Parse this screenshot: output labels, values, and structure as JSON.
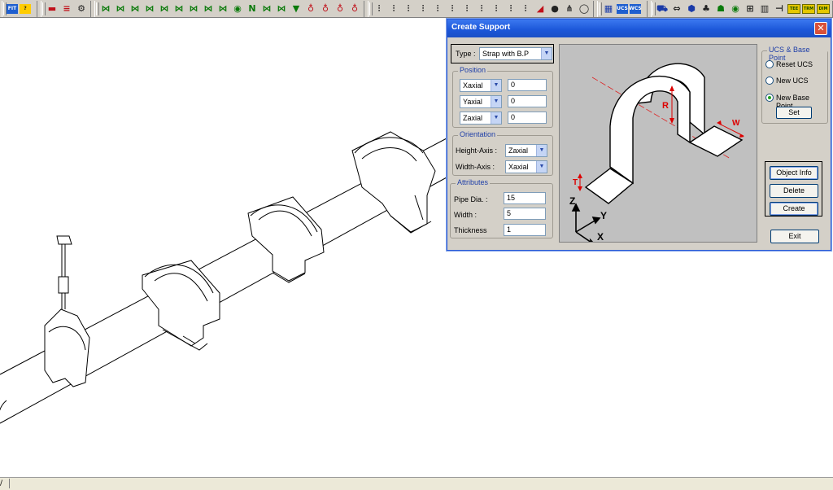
{
  "toolbar": {
    "groups": [
      {
        "buttons": [
          {
            "icon": "fit-icon",
            "label": "FIT",
            "style": "sq"
          },
          {
            "icon": "help-icon",
            "label": "?",
            "style": "ysq"
          }
        ]
      },
      {
        "buttons": [
          {
            "icon": "delete-icon",
            "label": "▬",
            "style": "red"
          },
          {
            "icon": "list-icon",
            "label": "≡",
            "style": "red"
          },
          {
            "icon": "settings-icon",
            "label": "⚙",
            "style": "dark"
          }
        ]
      },
      {
        "buttons": [
          {
            "icon": "valve-icon",
            "label": "⋈",
            "style": "green"
          },
          {
            "icon": "valve-icon",
            "label": "⋈",
            "style": "green"
          },
          {
            "icon": "valve-icon",
            "label": "⋈",
            "style": "green"
          },
          {
            "icon": "valve-icon",
            "label": "⋈",
            "style": "green"
          },
          {
            "icon": "valve-icon",
            "label": "⋈",
            "style": "green"
          },
          {
            "icon": "valve-icon",
            "label": "⋈",
            "style": "green"
          },
          {
            "icon": "valve-icon",
            "label": "⋈",
            "style": "green"
          },
          {
            "icon": "valve-icon",
            "label": "⋈",
            "style": "green"
          },
          {
            "icon": "valve-icon",
            "label": "⋈",
            "style": "green"
          },
          {
            "icon": "valve-icon",
            "label": "◉",
            "style": "green"
          },
          {
            "icon": "valve-icon",
            "label": "N",
            "style": "green"
          },
          {
            "icon": "valve-icon",
            "label": "⋈",
            "style": "green"
          },
          {
            "icon": "valve-icon",
            "label": "⋈",
            "style": "green"
          },
          {
            "icon": "valve-icon",
            "label": "▼",
            "style": "green"
          },
          {
            "icon": "spring-icon",
            "label": "♁",
            "style": "red"
          },
          {
            "icon": "spring-icon",
            "label": "♁",
            "style": "red"
          },
          {
            "icon": "spring-icon",
            "label": "♁",
            "style": "red"
          },
          {
            "icon": "spring-icon",
            "label": "♁",
            "style": "red"
          }
        ]
      },
      {
        "buttons": [
          {
            "icon": "support-icon",
            "label": "⫶",
            "style": "dark"
          },
          {
            "icon": "support-icon",
            "label": "⫶",
            "style": "dark"
          },
          {
            "icon": "support-icon",
            "label": "⫶",
            "style": "dark"
          },
          {
            "icon": "support-icon",
            "label": "⫶",
            "style": "dark"
          },
          {
            "icon": "support-icon",
            "label": "⫶",
            "style": "dark"
          },
          {
            "icon": "support-icon",
            "label": "⫶",
            "style": "dark"
          },
          {
            "icon": "support-icon",
            "label": "⫶",
            "style": "dark"
          },
          {
            "icon": "support-icon",
            "label": "⫶",
            "style": "dark"
          },
          {
            "icon": "support-icon",
            "label": "⫶",
            "style": "dark"
          },
          {
            "icon": "support-icon",
            "label": "⫶",
            "style": "dark"
          },
          {
            "icon": "support-icon",
            "label": "⫶",
            "style": "dark"
          },
          {
            "icon": "support-icon",
            "label": "◢",
            "style": "red"
          },
          {
            "icon": "support-icon",
            "label": "●",
            "style": "dark"
          },
          {
            "icon": "support-icon",
            "label": "⋔",
            "style": "dark"
          },
          {
            "icon": "support-icon",
            "label": "◯",
            "style": "dark"
          }
        ]
      },
      {
        "buttons": [
          {
            "icon": "grid-icon",
            "label": "▦",
            "style": "blue"
          },
          {
            "icon": "ucs-icon",
            "label": "UCS",
            "style": "sq"
          },
          {
            "icon": "wcs-icon",
            "label": "WCS",
            "style": "sq"
          }
        ]
      },
      {
        "buttons": [
          {
            "icon": "select-icon",
            "label": "⛟",
            "style": "blue"
          },
          {
            "icon": "select-icon",
            "label": "⇔",
            "style": "dark"
          },
          {
            "icon": "select-icon",
            "label": "⬢",
            "style": "blue"
          },
          {
            "icon": "select-icon",
            "label": "♣",
            "style": "dark"
          },
          {
            "icon": "select-icon",
            "label": "☗",
            "style": "green"
          },
          {
            "icon": "select-icon",
            "label": "◉",
            "style": "green"
          },
          {
            "icon": "select-icon",
            "label": "⊞",
            "style": "dark"
          },
          {
            "icon": "select-icon",
            "label": "▥",
            "style": "dark"
          },
          {
            "icon": "select-icon",
            "label": "⊣",
            "style": "dark"
          },
          {
            "icon": "tee-icon",
            "label": "TEE",
            "style": "gsq"
          },
          {
            "icon": "trim-icon",
            "label": "TRM",
            "style": "gsq"
          },
          {
            "icon": "dimension-icon",
            "label": "DIM",
            "style": "gsq"
          }
        ]
      }
    ]
  },
  "dialog": {
    "title": "Create Support",
    "close_label": "✕",
    "type": {
      "label": "Type :",
      "value": "Strap with B.P"
    },
    "position": {
      "title": "Position",
      "rows": [
        {
          "axis": "Xaxial",
          "value": "0"
        },
        {
          "axis": "Yaxial",
          "value": "0"
        },
        {
          "axis": "Zaxial",
          "value": "0"
        }
      ]
    },
    "orientation": {
      "title": "Orientation",
      "height_axis": {
        "label": "Height-Axis :",
        "value": "Zaxial"
      },
      "width_axis": {
        "label": "Width-Axis :",
        "value": "Xaxial"
      }
    },
    "attributes": {
      "title": "Attributes",
      "pipe_dia": {
        "label": "Pipe Dia. :",
        "value": "15"
      },
      "width": {
        "label": "Width  :",
        "value": "5"
      },
      "thickness": {
        "label": "Thickness",
        "value": "1"
      }
    },
    "ucs": {
      "title": "UCS & Base Point",
      "options": [
        {
          "label": "Reset UCS",
          "checked": false
        },
        {
          "label": "New UCS",
          "checked": false
        },
        {
          "label": "New Base Point",
          "checked": true
        }
      ],
      "set_label": "Set"
    },
    "buttons": {
      "object_info": "Object Info",
      "delete": "Delete",
      "create": "Create",
      "exit": "Exit"
    },
    "preview": {
      "dim_r": "R",
      "dim_w": "W",
      "dim_t": "T",
      "axis_z": "Z",
      "axis_y": "Y",
      "axis_x": "X"
    }
  },
  "status": {
    "tab_label": "/"
  },
  "colors": {
    "titlebar": "#1b56d8",
    "group_title": "#1f3fa8",
    "dimension_red": "#e00000",
    "dialog_bg": "#d4d0c8"
  }
}
